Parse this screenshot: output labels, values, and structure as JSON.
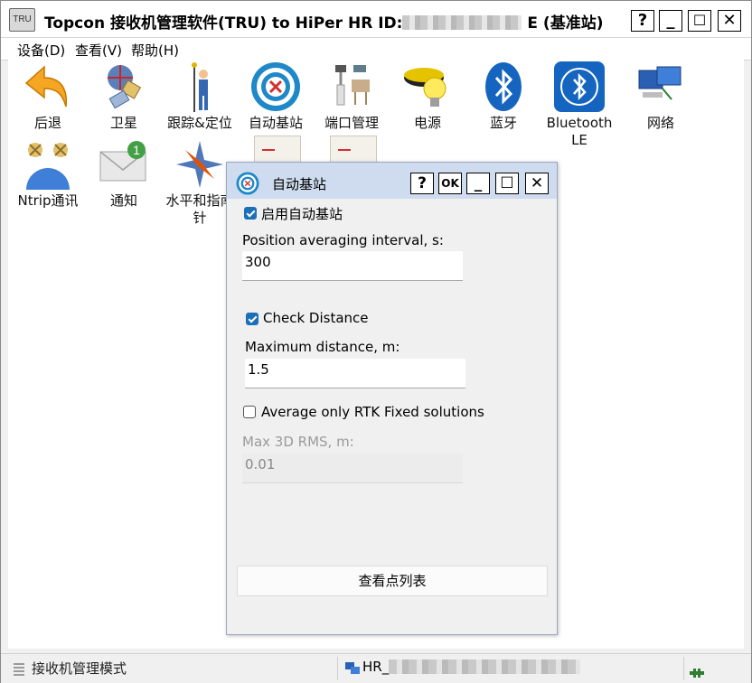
{
  "window": {
    "app_icon_text": "TRU",
    "title_prefix": "Topcon 接收机管理软件(TRU) to HiPer HR ID:",
    "title_suffix": "E (基准站)",
    "help_button": "?",
    "minimize_button": "_",
    "maximize_button": "☐",
    "close_button": "✕"
  },
  "menu": {
    "items": [
      "设备(D)",
      "查看(V)",
      "帮助(H)"
    ]
  },
  "tiles": [
    {
      "label": "后退",
      "icon": "back-arrow-icon"
    },
    {
      "label": "卫星",
      "icon": "satellite-icon"
    },
    {
      "label": "跟踪&定位",
      "icon": "surveyor-icon"
    },
    {
      "label": "自动基站",
      "icon": "target-icon"
    },
    {
      "label": "端口管理",
      "icon": "port-connector-icon"
    },
    {
      "label": "电源",
      "icon": "power-bulb-icon"
    },
    {
      "label": "蓝牙",
      "icon": "bluetooth-icon"
    },
    {
      "label": "Bluetooth LE",
      "icon": "bluetooth-le-icon"
    },
    {
      "label": "网络",
      "icon": "network-icon"
    },
    {
      "label": "Ntrip通讯",
      "icon": "ntrip-icon"
    },
    {
      "label": "通知",
      "icon": "mail-notification-icon"
    },
    {
      "label": "水平和指南针",
      "icon": "compass-icon"
    }
  ],
  "dialog": {
    "title": "自动基站",
    "help_button": "?",
    "ok_button": "OK",
    "minimize_button": "_",
    "maximize_button": "☐",
    "close_button": "✕",
    "enable_auto_base": {
      "label": "启用自动基站",
      "checked": true
    },
    "averaging_interval": {
      "label": "Position averaging interval, s:",
      "value": "300"
    },
    "check_distance": {
      "label": "Check Distance",
      "checked": true
    },
    "max_distance": {
      "label": "Maximum distance, m:",
      "value": "1.5"
    },
    "rtk_fixed_only": {
      "label": "Average only RTK Fixed solutions",
      "checked": false
    },
    "max_rms": {
      "label": "Max 3D RMS, m:",
      "value": "0.01"
    },
    "view_points_button": "查看点列表"
  },
  "status": {
    "mode": "接收机管理模式",
    "receiver_prefix": "HR_"
  },
  "colors": {
    "dialog_title_bg": "#cfdcef",
    "checkbox_accent": "#1c6fb8",
    "bluetooth_blue": "#1565c0"
  }
}
